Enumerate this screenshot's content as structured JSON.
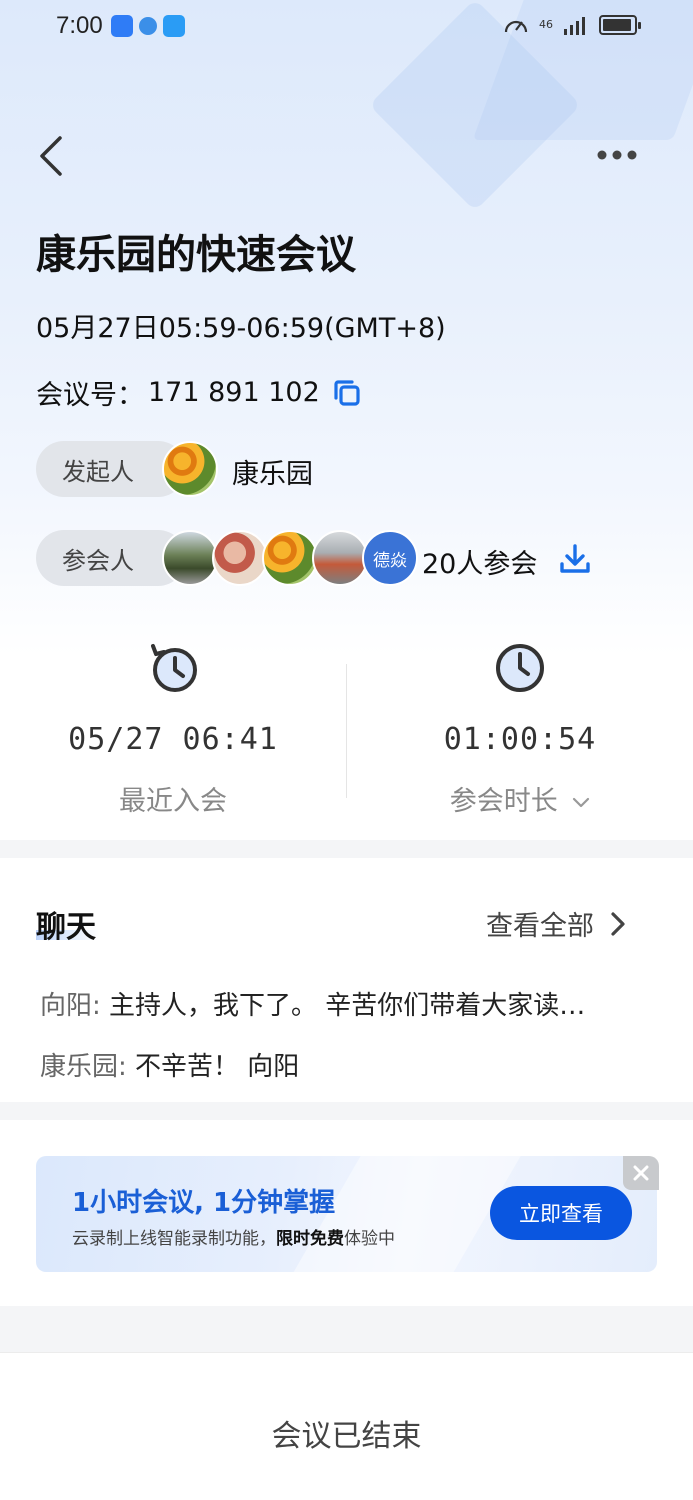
{
  "status_bar": {
    "time": "7:00",
    "network": "46"
  },
  "header": {
    "back_icon": "chevron-left-icon",
    "more_icon": "more-dots-icon"
  },
  "meeting": {
    "title": "康乐园的快速会议",
    "time_range": "05月27日05:59-06:59(GMT+8)",
    "number_label": "会议号：",
    "number": "171 891 102"
  },
  "initiator": {
    "label": "发起人",
    "name": "康乐园"
  },
  "attendees": {
    "label": "参会人",
    "avatar_text": "德焱",
    "count_text": "20人参会"
  },
  "stats": {
    "last_join": {
      "value": "05/27 06:41",
      "label": "最近入会"
    },
    "duration": {
      "value": "01:00:54",
      "label": "参会时长"
    }
  },
  "chat": {
    "title": "聊天",
    "view_all": "查看全部",
    "messages": [
      {
        "sender": "向阳:",
        "text": " 主持人，我下了。 辛苦你们带着大家读…"
      },
      {
        "sender": "康乐园:",
        "text": " 不辛苦！ 向阳"
      }
    ]
  },
  "promo": {
    "title": "1小时会议, 1分钟掌握",
    "sub_prefix": "云录制上线智能录制功能，",
    "sub_bold": "限时免费",
    "sub_suffix": "体验中",
    "button": "立即查看"
  },
  "footer": {
    "status": "会议已结束"
  },
  "colors": {
    "accent": "#0a56e0",
    "copy_icon": "#1a6fe8",
    "banner_title": "#1a5fd6"
  }
}
